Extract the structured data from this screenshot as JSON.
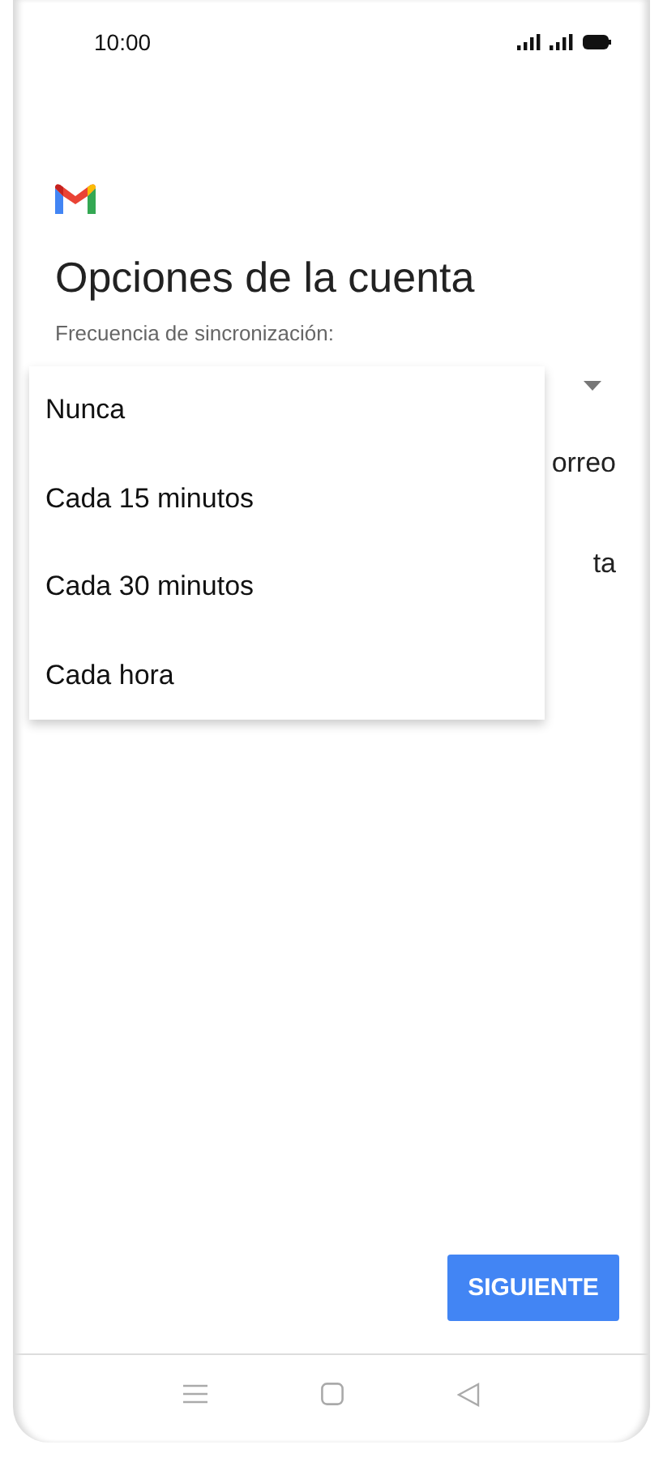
{
  "status_bar": {
    "time": "10:00"
  },
  "title": "Opciones de la cuenta",
  "sync_label": "Frecuencia de sincronización:",
  "background_rows": [
    {
      "text": "orreo"
    },
    {
      "text": "ta"
    }
  ],
  "menu": {
    "items": [
      {
        "label": "Nunca"
      },
      {
        "label": "Cada 15 minutos"
      },
      {
        "label": "Cada 30 minutos"
      },
      {
        "label": "Cada hora"
      }
    ]
  },
  "next_button": "SIGUIENTE"
}
